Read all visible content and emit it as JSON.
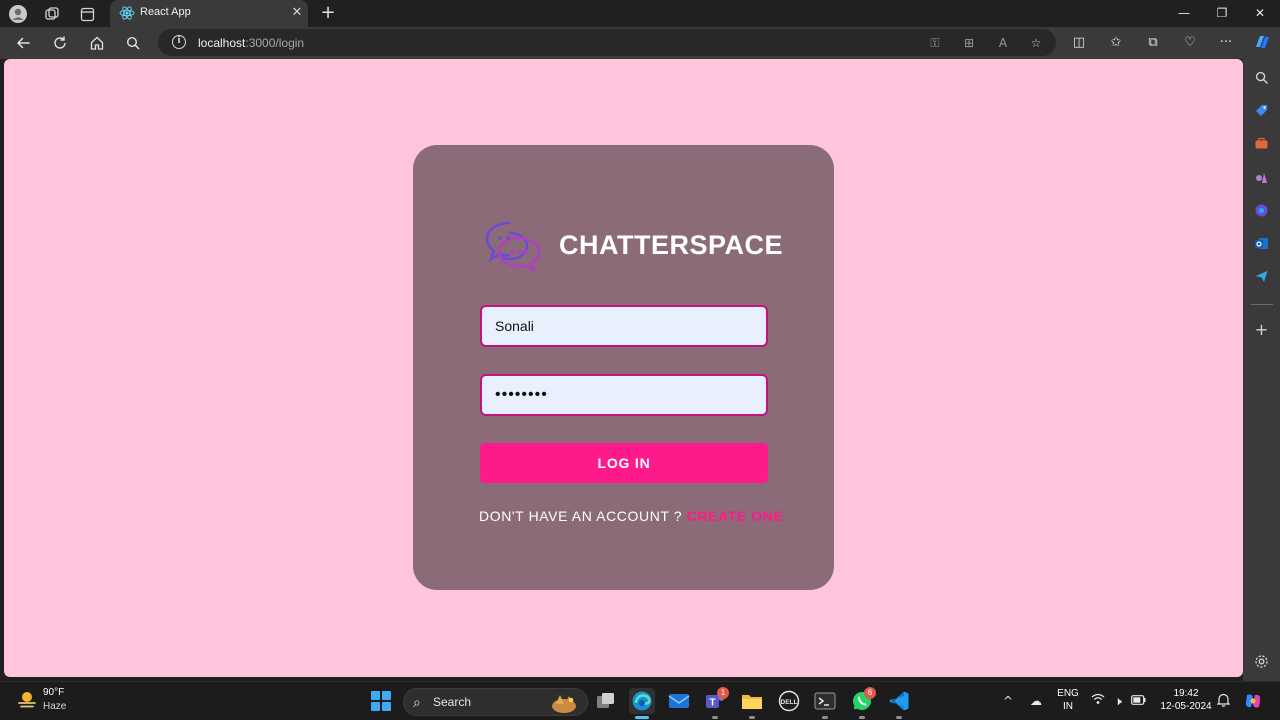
{
  "browser": {
    "tab": {
      "title": "React App"
    },
    "address": {
      "host": "localhost",
      "path": ":3000/login"
    }
  },
  "page": {
    "brand": "CHATTERSPACE",
    "username": {
      "value": "Sonali"
    },
    "password": {
      "value": "12345678"
    },
    "login_label": "LOG IN",
    "signup_prompt": "DON'T HAVE AN ACCOUNT ?",
    "signup_link": "CREATE ONE",
    "colors": {
      "background": "#ffc4de",
      "card": "#8b6b77",
      "accent": "#ff1a8c",
      "field_border": "#c2147d"
    }
  },
  "taskbar": {
    "weather": {
      "temp": "90°F",
      "condition": "Haze"
    },
    "search_label": "Search",
    "badges": {
      "teams": "1",
      "whatsapp": "6"
    },
    "language": {
      "line1": "ENG",
      "line2": "IN"
    },
    "clock": {
      "time": "19:42",
      "date": "12-05-2024"
    }
  }
}
